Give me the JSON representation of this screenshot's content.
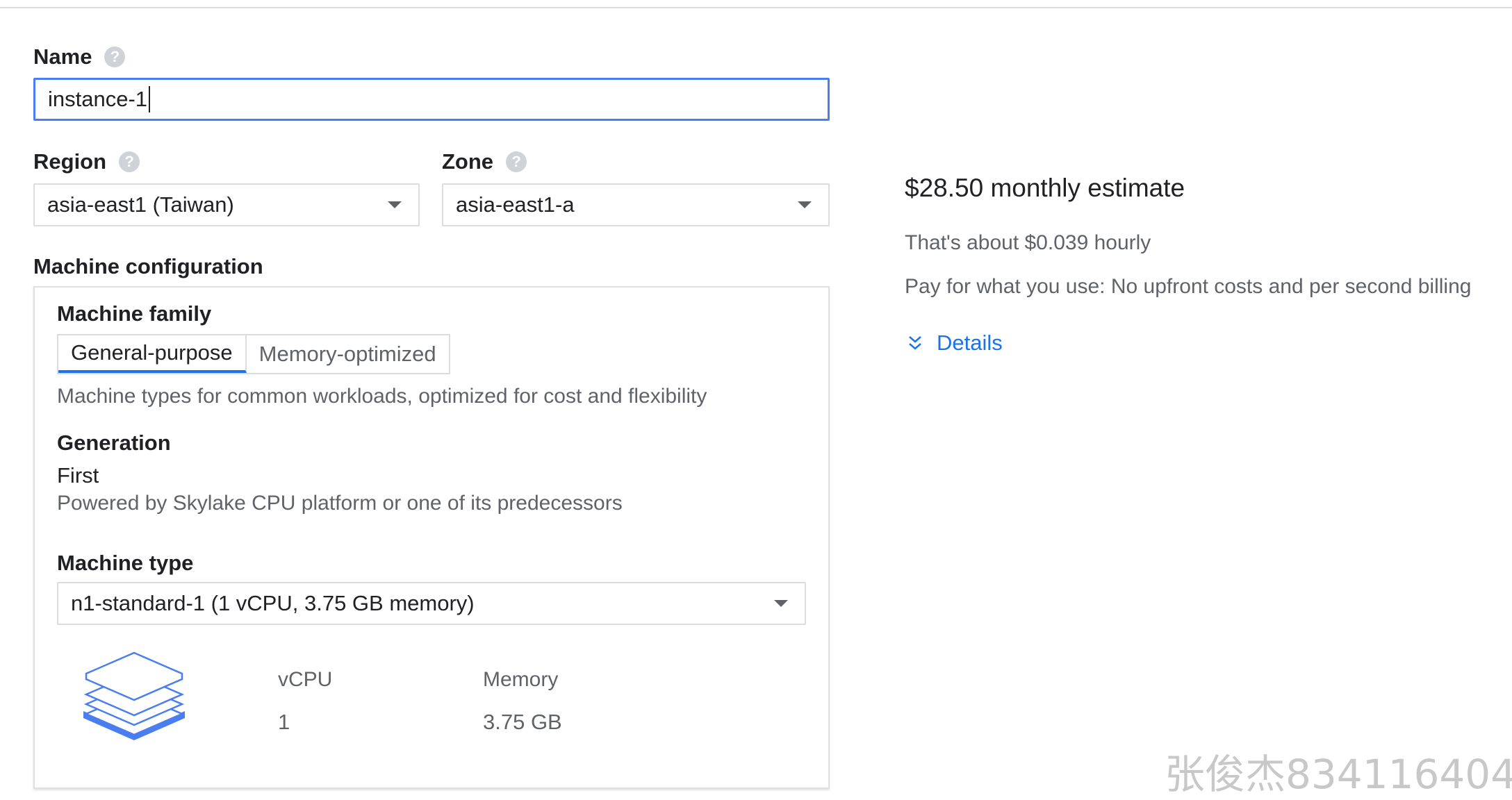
{
  "name": {
    "label": "Name",
    "help_icon": "help-circle-icon",
    "value": "instance-1"
  },
  "region": {
    "label": "Region",
    "help_icon": "help-circle-icon",
    "selected": "asia-east1 (Taiwan)"
  },
  "zone": {
    "label": "Zone",
    "help_icon": "help-circle-icon",
    "selected": "asia-east1-a"
  },
  "machine_configuration": {
    "label": "Machine configuration",
    "family": {
      "label": "Machine family",
      "tabs": [
        {
          "label": "General-purpose",
          "active": true
        },
        {
          "label": "Memory-optimized",
          "active": false
        }
      ],
      "description": "Machine types for common workloads, optimized for cost and flexibility"
    },
    "generation": {
      "label": "Generation",
      "value": "First",
      "description": "Powered by Skylake CPU platform or one of its predecessors"
    },
    "machine_type": {
      "label": "Machine type",
      "selected": "n1-standard-1 (1 vCPU, 3.75 GB memory)"
    },
    "specs": {
      "icon": "stacked-layers-icon",
      "vcpu_label": "vCPU",
      "vcpu_value": "1",
      "memory_label": "Memory",
      "memory_value": "3.75 GB"
    }
  },
  "estimate": {
    "title": "$28.50 monthly estimate",
    "hourly": "That's about $0.039 hourly",
    "billing": "Pay for what you use: No upfront costs and per second billing",
    "details_label": "Details",
    "details_icon": "double-chevron-down-icon"
  },
  "watermark": "张俊杰834116404",
  "colors": {
    "accent": "#1a73e8",
    "input_focus": "#4a7ef0",
    "border": "#dadce0",
    "secondary_text": "#5f6368"
  }
}
